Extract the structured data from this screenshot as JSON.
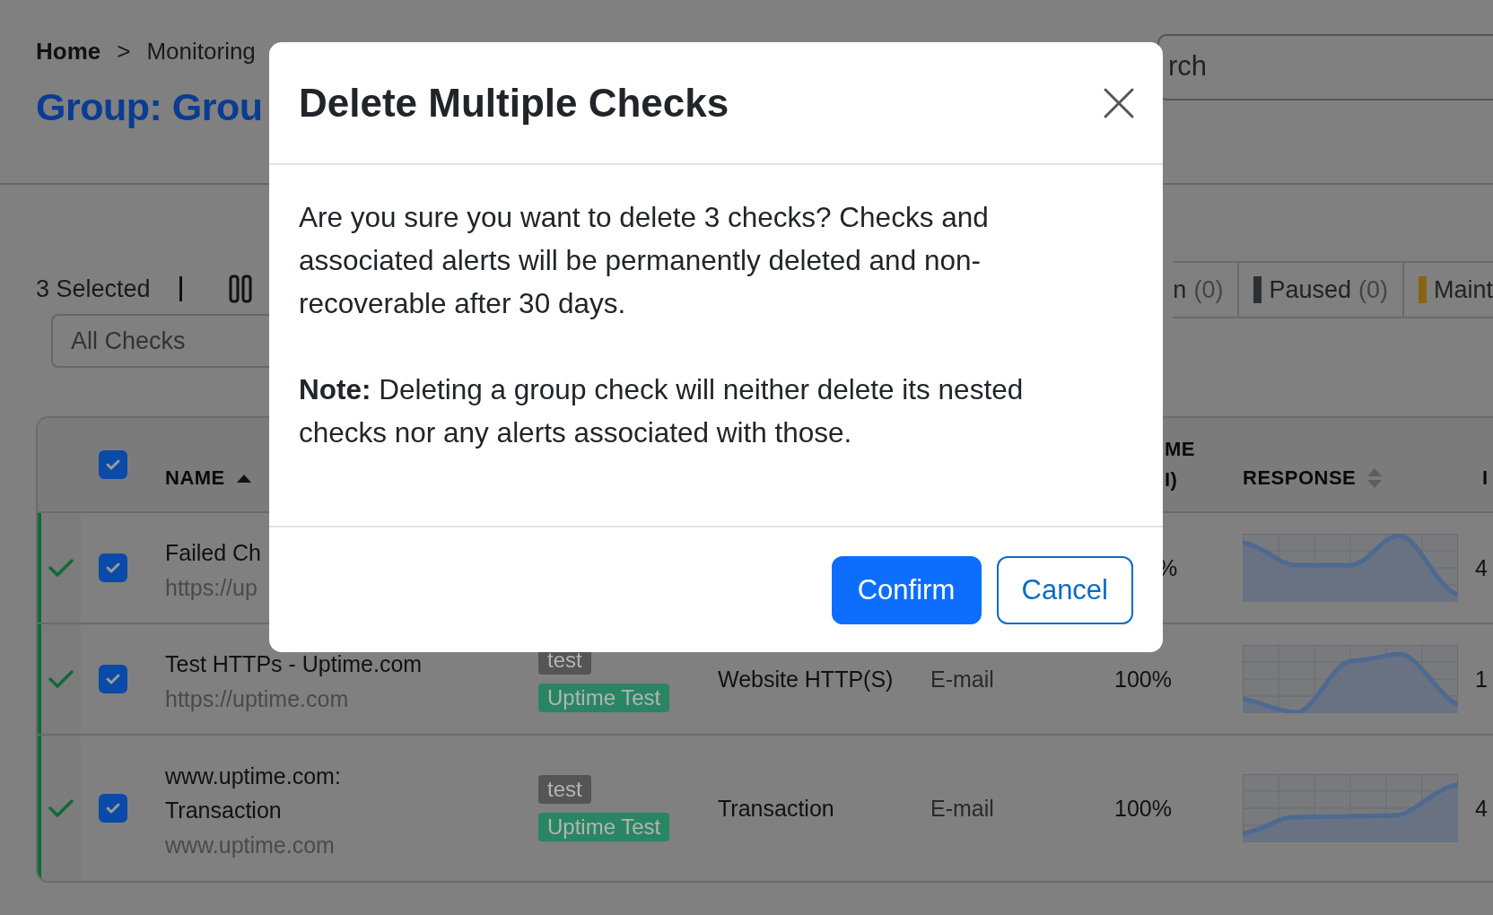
{
  "breadcrumb": {
    "items": [
      "Home",
      "Monitoring"
    ],
    "separator": ">"
  },
  "page_title": "Group: Grou",
  "search": {
    "placeholder": "rch"
  },
  "selection": {
    "count_label": "3 Selected"
  },
  "status_tabs": [
    {
      "label": "n",
      "count": "(0)"
    },
    {
      "label": "Paused",
      "count": "(0)",
      "color": "#2c2f33"
    },
    {
      "label": "Maint",
      "color": "#8a6410"
    }
  ],
  "filter": {
    "value": "All Checks"
  },
  "table": {
    "select_all": {
      "checked": true
    },
    "header": {
      "name": {
        "label": "NAME",
        "sorted": true
      },
      "column_7": {
        "lines": [
          "ME",
          "I)"
        ]
      },
      "response": {
        "label": "RESPONSE",
        "sorted": false
      },
      "column_9": {
        "label": "I"
      }
    },
    "rows": [
      {
        "ok": true,
        "selected": true,
        "name": "Failed Ch",
        "url": "https://up",
        "uptime": "%",
        "column_9": "4"
      },
      {
        "ok": true,
        "selected": true,
        "name": "Test HTTPs - Uptime.com",
        "url": "https://uptime.com",
        "tags": [
          {
            "label": "test",
            "color": "#555555"
          },
          {
            "label": "Uptime Test",
            "color": "#2a8565"
          }
        ],
        "type": "Website HTTP(S)",
        "alerts": "E-mail",
        "uptime": "100%",
        "column_9": "1"
      },
      {
        "ok": true,
        "selected": true,
        "name": "www.uptime.com: Transaction",
        "url": "www.uptime.com",
        "tags": [
          {
            "label": "test",
            "color": "#555555"
          },
          {
            "label": "Uptime Test",
            "color": "#2a8565"
          }
        ],
        "type": "Transaction",
        "alerts": "E-mail",
        "uptime": "100%",
        "column_9": "4"
      }
    ]
  },
  "modal": {
    "title": "Delete Multiple Checks",
    "paragraphs": [
      "Are you sure you want to delete 3 checks? Checks and associated alerts will be permanently deleted and non-recoverable after 30 days.",
      "**Note:** Deleting a group check will neither delete its nested checks nor any alerts associated with those."
    ],
    "buttons": [
      {
        "label": "Confirm",
        "kind": "primary"
      },
      {
        "label": "Cancel",
        "kind": "outline"
      }
    ]
  }
}
